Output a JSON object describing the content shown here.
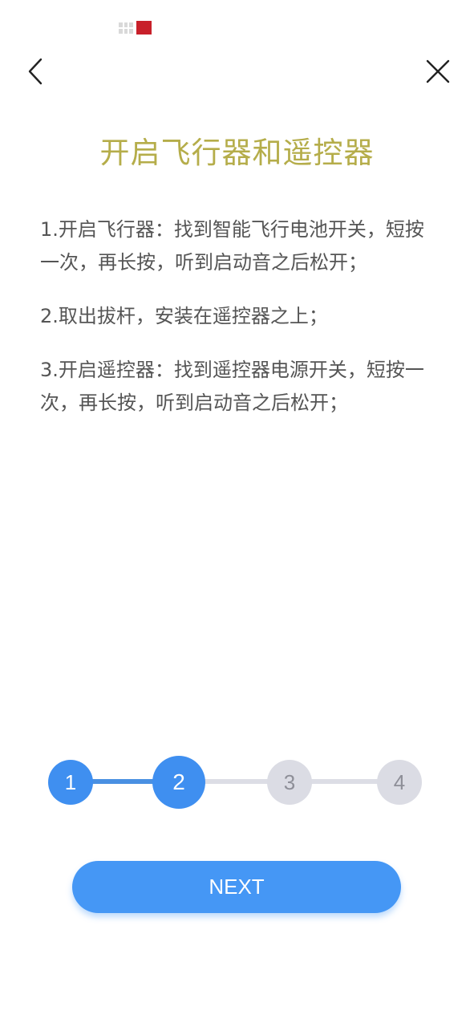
{
  "header": {
    "title": "开启飞行器和遥控器"
  },
  "icons": {
    "back": "chevron-left-icon",
    "close": "close-icon"
  },
  "instructions": [
    "1.开启飞行器：找到智能飞行电池开关，短按一次，再长按，听到启动音之后松开；",
    "2.取出拔杆，安装在遥控器之上；",
    "3.开启遥控器：找到遥控器电源开关，短按一次，再长按，听到启动音之后松开；"
  ],
  "progress": {
    "current_step": 2,
    "total_steps": 4,
    "steps": [
      "1",
      "2",
      "3",
      "4"
    ]
  },
  "actions": {
    "next_label": "NEXT"
  },
  "colors": {
    "title": "#b5ad4a",
    "accent": "#3f8ff0",
    "inactive": "#dbdce4",
    "text": "#555555"
  }
}
